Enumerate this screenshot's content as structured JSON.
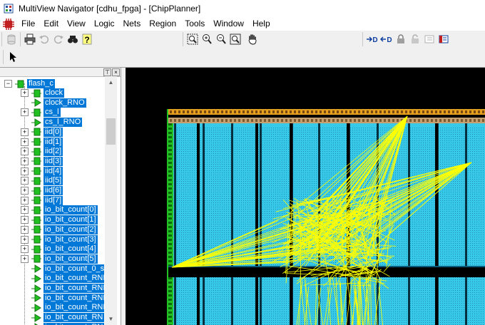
{
  "window": {
    "title": "MultiView Navigator [cdhu_fpga] - [ChipPlanner]"
  },
  "menu": [
    "File",
    "Edit",
    "View",
    "Logic",
    "Nets",
    "Region",
    "Tools",
    "Window",
    "Help"
  ],
  "toolbar": {
    "icons": [
      "cylinder-icon",
      "print-icon",
      "undo-icon",
      "redo-icon",
      "find-icon",
      "help-icon",
      "zoom-fit-icon",
      "zoom-in-icon",
      "zoom-out-icon",
      "zoom-box-icon",
      "hand-pan-icon",
      "add-input-icon",
      "add-output-icon",
      "lock-icon",
      "unlock-icon",
      "sidebar-a-icon",
      "sidebar-b-icon"
    ]
  },
  "tree": {
    "root": {
      "label": "flash_c",
      "expanded": true
    },
    "items": [
      {
        "label": "clock",
        "expandable": true,
        "selected": true,
        "icon": "green-net-icon"
      },
      {
        "label": "clock_RNO",
        "expandable": false,
        "selected": true,
        "icon": "arrow-net-icon"
      },
      {
        "label": "cs_l",
        "expandable": true,
        "selected": true,
        "icon": "green-net-icon"
      },
      {
        "label": "cs_l_RNO",
        "expandable": false,
        "selected": true,
        "icon": "arrow-net-icon"
      },
      {
        "label": "iid[0]",
        "expandable": true,
        "selected": true,
        "icon": "green-net-icon"
      },
      {
        "label": "iid[1]",
        "expandable": true,
        "selected": true,
        "icon": "green-net-icon"
      },
      {
        "label": "iid[2]",
        "expandable": true,
        "selected": true,
        "icon": "green-net-icon"
      },
      {
        "label": "iid[3]",
        "expandable": true,
        "selected": true,
        "icon": "green-net-icon"
      },
      {
        "label": "iid[4]",
        "expandable": true,
        "selected": true,
        "icon": "green-net-icon"
      },
      {
        "label": "iid[5]",
        "expandable": true,
        "selected": true,
        "icon": "green-net-icon"
      },
      {
        "label": "iid[6]",
        "expandable": true,
        "selected": true,
        "icon": "green-net-icon"
      },
      {
        "label": "iid[7]",
        "expandable": true,
        "selected": true,
        "icon": "green-net-icon"
      },
      {
        "label": "io_bit_count[0]",
        "expandable": true,
        "selected": true,
        "icon": "green-net-icon"
      },
      {
        "label": "io_bit_count[1]",
        "expandable": true,
        "selected": true,
        "icon": "green-net-icon"
      },
      {
        "label": "io_bit_count[2]",
        "expandable": true,
        "selected": true,
        "icon": "green-net-icon"
      },
      {
        "label": "io_bit_count[3]",
        "expandable": true,
        "selected": true,
        "icon": "green-net-icon"
      },
      {
        "label": "io_bit_count[4]",
        "expandable": true,
        "selected": true,
        "icon": "green-net-icon"
      },
      {
        "label": "io_bit_count[5]",
        "expandable": true,
        "selected": true,
        "icon": "green-net-icon"
      },
      {
        "label": "io_bit_count_0_s",
        "expandable": false,
        "selected": true,
        "icon": "arrow-net-icon"
      },
      {
        "label": "io_bit_count_RNI",
        "expandable": false,
        "selected": true,
        "icon": "arrow-net-icon"
      },
      {
        "label": "io_bit_count_RNI",
        "expandable": false,
        "selected": true,
        "icon": "arrow-net-icon"
      },
      {
        "label": "io_bit_count_RNI",
        "expandable": false,
        "selected": true,
        "icon": "arrow-net-icon"
      },
      {
        "label": "io_bit_count_RNI",
        "expandable": false,
        "selected": true,
        "icon": "arrow-net-icon"
      },
      {
        "label": "io_bit_count_RN",
        "expandable": false,
        "selected": true,
        "icon": "arrow-net-icon"
      },
      {
        "label": "io_bit_count_RN",
        "expandable": false,
        "selected": true,
        "icon": "arrow-net-icon"
      }
    ]
  },
  "panel_header_buttons": [
    "⊤",
    "×"
  ],
  "colors": {
    "selection": "#0078d7",
    "canvas": "#000000",
    "fabric": "#38c8e8",
    "nets": "#ffff00",
    "io": "#22c022"
  }
}
